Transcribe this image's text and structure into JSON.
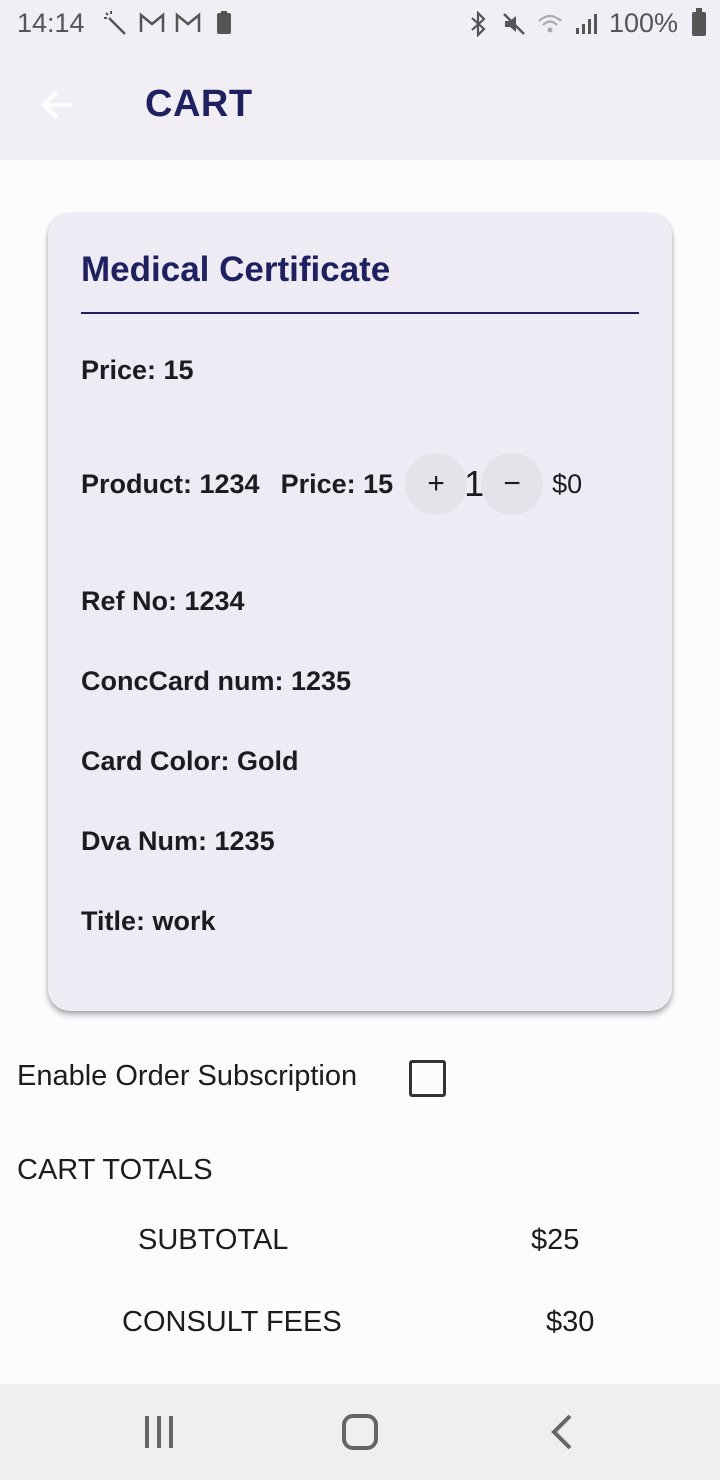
{
  "status_bar": {
    "time": "14:14",
    "battery": "100%",
    "left_icons": [
      "magic-wand-icon",
      "gmail-icon",
      "gmail-icon",
      "battery-saver-icon"
    ],
    "right_icons": [
      "bluetooth-icon",
      "mute-icon",
      "wifi-icon",
      "signal-icon",
      "battery-icon"
    ]
  },
  "app_bar": {
    "title": "CART"
  },
  "cart_item": {
    "title": "Medical Certificate",
    "price_line": "Price: 15",
    "product": "Product: 1234",
    "product_price": "Price: 15",
    "quantity": "1",
    "increment_label": "+",
    "decrement_label": "−",
    "line_total": "$0",
    "ref_no": "Ref No: 1234",
    "conc_card": "ConcCard num: 1235",
    "card_color": "Card Color: Gold",
    "dva_num": "Dva Num: 1235",
    "title_field": "Title: work"
  },
  "subscription": {
    "label": "Enable Order Subscription",
    "checked": false
  },
  "totals": {
    "heading": "CART TOTALS",
    "subtotal_label": "SUBTOTAL",
    "subtotal_value": "$25",
    "consult_label": "CONSULT FEES",
    "consult_value": "$30"
  },
  "colors": {
    "primary_text": "#1e2060",
    "app_bar_bg": "#f1eff5",
    "card_bg": "#efebf4",
    "page_bg": "#fefbff"
  },
  "nav_bar": {
    "icons": [
      "recent-apps-icon",
      "home-icon",
      "back-icon"
    ]
  }
}
